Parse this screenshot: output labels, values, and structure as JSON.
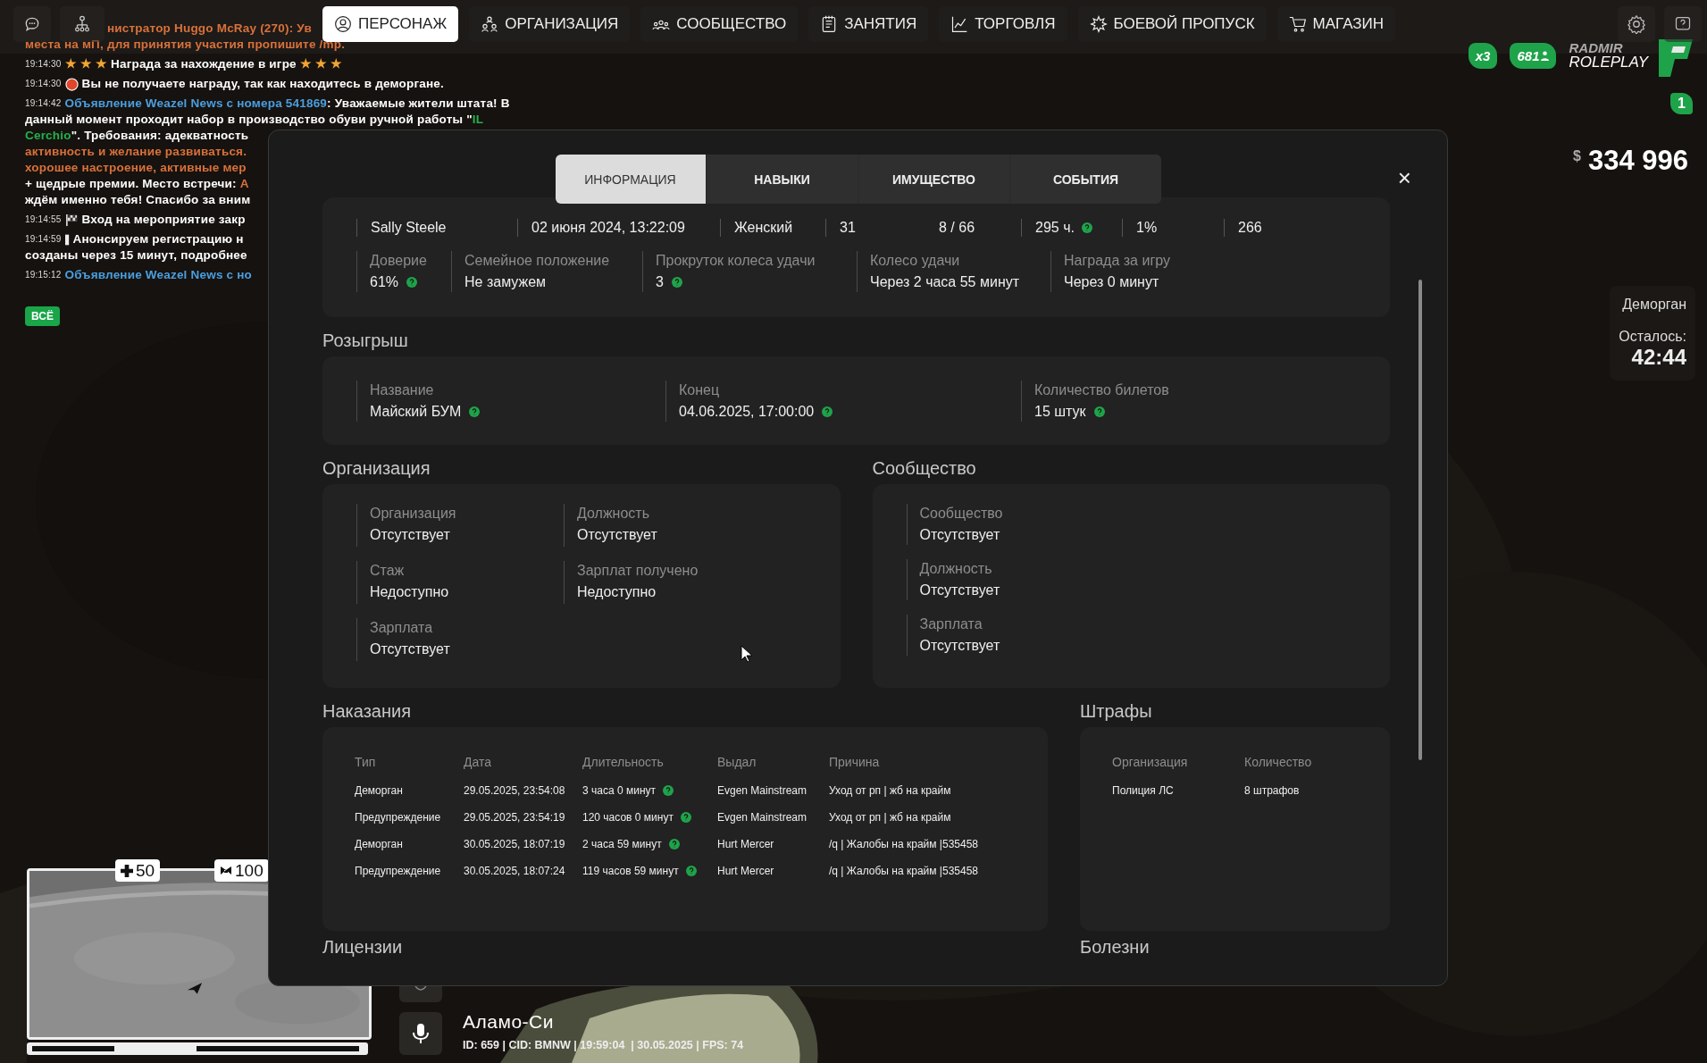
{
  "nav_tabs": [
    {
      "label": "ПЕРСОНАЖ",
      "selected": true
    },
    {
      "label": "ОРГАНИЗАЦИЯ",
      "selected": false
    },
    {
      "label": "СООБЩЕСТВО",
      "selected": false
    },
    {
      "label": "ЗАНЯТИЯ",
      "selected": false
    },
    {
      "label": "ТОРГОВЛЯ",
      "selected": false
    },
    {
      "label": "БОЕВОЙ ПРОПУСК",
      "selected": false
    },
    {
      "label": "МАГАЗИН",
      "selected": false
    }
  ],
  "chat": {
    "lines": [
      {
        "kind": "text",
        "parts": [
          {
            "text": "нистратор Huggo McRay (270): Ув",
            "color": "#d9713a"
          }
        ]
      },
      {
        "kind": "text",
        "parts": [
          {
            "text": "места на мП, для принятия участия пропишите /mp.",
            "color": "#d9713a"
          }
        ]
      },
      {
        "kind": "text",
        "time": "19:14:30",
        "parts": [
          {
            "text": "★ ★ ★ ",
            "color": "#f2a533"
          },
          {
            "text": "Награда за нахождение в игре ",
            "color": "#ffffff"
          },
          {
            "text": "★ ★ ★",
            "color": "#f2a533"
          }
        ]
      },
      {
        "kind": "alert",
        "time": "19:14:30",
        "parts": [
          {
            "text": "Вы не получаете награду, так как находитесь в деморгане.",
            "color": "#ffffff"
          }
        ]
      },
      {
        "kind": "text",
        "time": "19:14:42",
        "parts": [
          {
            "text": "Объявление Weazel News",
            "color": "#4a9fe0"
          },
          {
            "text": " с номера ",
            "color": "#4a9fe0"
          },
          {
            "text": "541869",
            "color": "#4a9fe0"
          },
          {
            "text": ": Уважаемые жители штата! В",
            "color": "#ffffff"
          }
        ]
      },
      {
        "kind": "text",
        "parts": [
          {
            "text": "данный момент проходит набор в производство обуви ручной работы \"",
            "color": "#ffffff"
          },
          {
            "text": "IL",
            "color": "#22b14c"
          }
        ]
      },
      {
        "kind": "text",
        "parts": [
          {
            "text": "Cerchio",
            "color": "#22b14c"
          },
          {
            "text": "\". Требования: адекватность",
            "color": "#ffffff"
          }
        ]
      },
      {
        "kind": "text",
        "parts": [
          {
            "text": "активность и желание развиваться.",
            "color": "#d9713a"
          }
        ]
      },
      {
        "kind": "text",
        "parts": [
          {
            "text": "хорошее настроение, активные мер",
            "color": "#d9713a"
          }
        ]
      },
      {
        "kind": "text",
        "parts": [
          {
            "text": "+ щедрые премии. Место встречи: ",
            "color": "#ffffff"
          },
          {
            "text": "А",
            "color": "#d9713a"
          }
        ]
      },
      {
        "kind": "text",
        "parts": [
          {
            "text": "ждём именно тебя! Спасибо за вним",
            "color": "#ffffff"
          }
        ]
      },
      {
        "kind": "flag",
        "time": "19:14:55",
        "parts": [
          {
            "text": "Вход на мероприятие закр",
            "color": "#ffffff"
          }
        ]
      },
      {
        "kind": "notice",
        "time": "19:14:59",
        "parts": [
          {
            "text": "Анонсируем регистрацию н",
            "color": "#ffffff"
          }
        ]
      },
      {
        "kind": "text",
        "parts": [
          {
            "text": "созданы через 15 минут, подробнее",
            "color": "#ffffff"
          }
        ]
      },
      {
        "kind": "text",
        "time": "19:15:12",
        "parts": [
          {
            "text": "Объявление Weazel News",
            "color": "#4a9fe0"
          },
          {
            "text": " с но",
            "color": "#4a9fe0"
          }
        ]
      }
    ],
    "filter_button": "ВСЁ"
  },
  "logo": {
    "multiplier": "x3",
    "online": "681",
    "brand_top": "RADMIR",
    "brand_bottom": "ROLEPLAY",
    "server": "1"
  },
  "money": {
    "currency": "$",
    "amount": "334 996"
  },
  "jail": {
    "title": "Деморган",
    "remaining_label": "Осталось:",
    "remaining": "42:44"
  },
  "minimap": {
    "health": "50",
    "armor": "100"
  },
  "location": {
    "zone": "Аламо-Си",
    "info": "ID: 659 | CID: BMNW | 19:59:04  | 30.05.2025 | FPS: 74"
  },
  "modal": {
    "tabs": [
      {
        "label": "ИНФОРМАЦИЯ",
        "selected": true
      },
      {
        "label": "НАВЫКИ",
        "selected": false
      },
      {
        "label": "ИМУЩЕСТВО",
        "selected": false
      },
      {
        "label": "СОБЫТИЯ",
        "selected": false
      }
    ],
    "close": "×",
    "summary": {
      "values": [
        {
          "text": "Sally Steele",
          "divider": true,
          "help": false
        },
        {
          "text": "02 июня 2024, 13:22:09",
          "divider": true,
          "help": false
        },
        {
          "text": "Женский",
          "divider": true,
          "help": false
        },
        {
          "text": "31",
          "divider": true,
          "help": false
        },
        {
          "text": "8 / 66",
          "divider": false,
          "help": false
        },
        {
          "text": "295 ч.",
          "divider": true,
          "help": true
        },
        {
          "text": "1%",
          "divider": true,
          "help": false
        },
        {
          "text": "266",
          "divider": true,
          "help": false
        }
      ],
      "fields": [
        {
          "label": "Доверие",
          "value": "61%",
          "help": true
        },
        {
          "label": "Семейное положение",
          "value": "Не замужем",
          "help": false
        },
        {
          "label": "Прокруток колеса удачи",
          "value": "3",
          "help": true
        },
        {
          "label": "Колесо удачи",
          "value": "Через 2 часа 55 минут",
          "help": false
        },
        {
          "label": "Награда за игру",
          "value": "Через 0 минут",
          "help": false
        }
      ]
    },
    "raffle": {
      "title": "Розыгрыш",
      "fields": [
        {
          "label": "Название",
          "value": "Майский БУМ",
          "help": true
        },
        {
          "label": "Конец",
          "value": "04.06.2025, 17:00:00",
          "help": true
        },
        {
          "label": "Количество билетов",
          "value": "15 штук",
          "help": true
        }
      ]
    },
    "organization": {
      "title": "Организация",
      "fields": [
        {
          "label": "Организация",
          "value": "Отсутствует",
          "help": false
        },
        {
          "label": "Должность",
          "value": "Отсутствует",
          "help": false
        },
        {
          "label": "Стаж",
          "value": "Недоступно",
          "help": false
        },
        {
          "label": "Зарплат получено",
          "value": "Недоступно",
          "help": false
        },
        {
          "label": "Зарплата",
          "value": "Отсутствует",
          "help": false
        }
      ]
    },
    "community": {
      "title": "Сообщество",
      "fields": [
        {
          "label": "Сообщество",
          "value": "Отсутствует",
          "help": false
        },
        {
          "label": "Должность",
          "value": "Отсутствует",
          "help": false
        },
        {
          "label": "Зарплата",
          "value": "Отсутствует",
          "help": false
        }
      ]
    },
    "punishments": {
      "title": "Наказания",
      "columns": [
        "Тип",
        "Дата",
        "Длительность",
        "Выдал",
        "Причина"
      ],
      "rows": [
        {
          "cells": [
            "Деморган",
            "29.05.2025, 23:54:08",
            "3 часа 0 минут",
            "Evgen Mainstream",
            "Уход от рп | жб на крайм"
          ],
          "help": true
        },
        {
          "cells": [
            "Предупреждение",
            "29.05.2025, 23:54:19",
            "120 часов 0 минут",
            "Evgen Mainstream",
            "Уход от рп | жб на крайм"
          ],
          "help": true
        },
        {
          "cells": [
            "Деморган",
            "30.05.2025, 18:07:19",
            "2 часа 59 минут",
            "Hurt Mercer",
            "/q | Жалобы на крайм |535458"
          ],
          "help": true
        },
        {
          "cells": [
            "Предупреждение",
            "30.05.2025, 18:07:24",
            "119 часов 59 минут",
            "Hurt Mercer",
            "/q | Жалобы на крайм |535458"
          ],
          "help": true
        }
      ]
    },
    "fines": {
      "title": "Штрафы",
      "columns": [
        "Организация",
        "Количество"
      ],
      "rows": [
        {
          "cells": [
            "Полиция ЛС",
            "8 штрафов"
          ]
        }
      ]
    },
    "licenses": {
      "title": "Лицензии"
    },
    "diseases": {
      "title": "Болезни"
    }
  }
}
